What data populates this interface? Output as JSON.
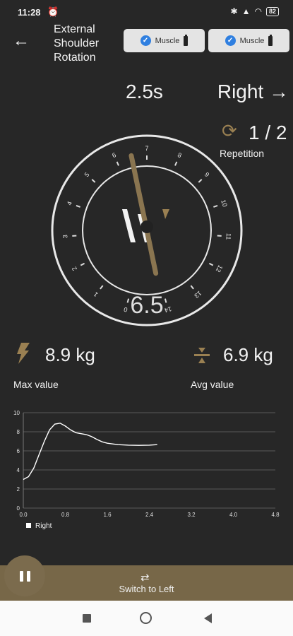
{
  "status": {
    "time": "11:28",
    "battery": "82"
  },
  "header": {
    "title": "External Shoulder Rotation"
  },
  "sensors": [
    {
      "label": "Muscle"
    },
    {
      "label": "Muscle"
    }
  ],
  "session": {
    "timer": "2.5s",
    "side": "Right →",
    "repetition": "1 / 2",
    "repetition_label": "Repetition"
  },
  "gauge": {
    "value": "6.5",
    "needle": 6.5,
    "ticks": [
      "0",
      "1",
      "2",
      "3",
      "4",
      "5",
      "6",
      "7",
      "8",
      "9",
      "10",
      "11",
      "12",
      "13",
      "14"
    ]
  },
  "stats": {
    "max_value": "8.9 kg",
    "max_label": "Max value",
    "avg_value": "6.9 kg",
    "avg_label": "Avg value"
  },
  "chart_data": {
    "type": "line",
    "series": [
      {
        "name": "Right",
        "x": [
          0.0,
          0.1,
          0.2,
          0.3,
          0.4,
          0.5,
          0.6,
          0.7,
          0.8,
          0.9,
          1.0,
          1.1,
          1.2,
          1.3,
          1.4,
          1.5,
          1.6,
          1.8,
          2.0,
          2.2,
          2.4,
          2.55
        ],
        "y": [
          3.0,
          3.3,
          4.2,
          5.6,
          7.0,
          8.2,
          8.8,
          8.9,
          8.6,
          8.2,
          7.9,
          7.8,
          7.7,
          7.5,
          7.2,
          6.95,
          6.8,
          6.65,
          6.6,
          6.58,
          6.6,
          6.65
        ]
      }
    ],
    "xticks": [
      "0.0",
      "0.8",
      "1.6",
      "2.4",
      "3.2",
      "4.0",
      "4.8"
    ],
    "yticks": [
      "0",
      "2",
      "4",
      "6",
      "8",
      "10"
    ],
    "xlim": [
      0,
      4.8
    ],
    "ylim": [
      0,
      10
    ],
    "grid": true,
    "legend": "bottom-left"
  },
  "bottom": {
    "switch_label": "Switch to Left"
  },
  "colors": {
    "accent": "#9a8052",
    "background": "#272727"
  }
}
